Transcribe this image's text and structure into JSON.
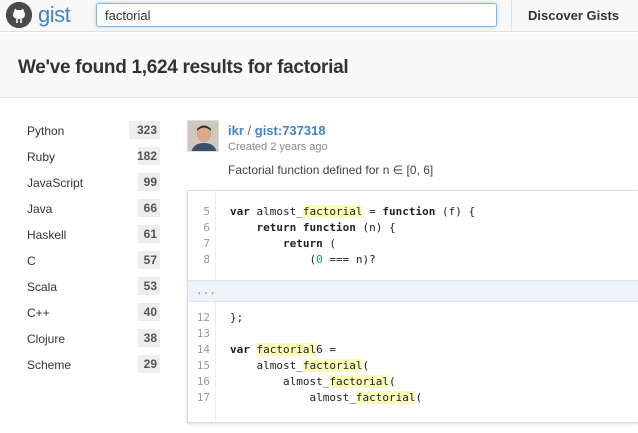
{
  "app": {
    "logo_text": "gist",
    "search_value": "factorial",
    "nav_discover": "Discover Gists"
  },
  "results": {
    "prefix": "We've found 1,624 results for ",
    "query": "factorial"
  },
  "languages": [
    {
      "name": "Python",
      "count": "323",
      "fraction": 1.0
    },
    {
      "name": "Ruby",
      "count": "182",
      "fraction": 0.56
    },
    {
      "name": "JavaScript",
      "count": "99",
      "fraction": 0.31
    },
    {
      "name": "Java",
      "count": "66",
      "fraction": 0.2
    },
    {
      "name": "Haskell",
      "count": "61",
      "fraction": 0.19
    },
    {
      "name": "C",
      "count": "57",
      "fraction": 0.18
    },
    {
      "name": "Scala",
      "count": "53",
      "fraction": 0.16
    },
    {
      "name": "C++",
      "count": "40",
      "fraction": 0.12
    },
    {
      "name": "Clojure",
      "count": "38",
      "fraction": 0.12
    },
    {
      "name": "Scheme",
      "count": "29",
      "fraction": 0.09
    }
  ],
  "gist": {
    "author": "ikr",
    "separator": " / ",
    "gist_id": "gist:737318",
    "created": "Created 2 years ago",
    "description": "Factorial function defined for n ∈ [0, 6]"
  },
  "code": {
    "ellipsis": "...",
    "lines_top": [
      {
        "num": "5",
        "html": "var almost_<span class=\"hl\">factorial</span> = function (f) {"
      },
      {
        "num": "6",
        "html": "    return function (n) {"
      },
      {
        "num": "7",
        "html": "        return ("
      },
      {
        "num": "8",
        "html": "            (<span class=\"num\">0</span> === n)?"
      }
    ],
    "lines_bottom": [
      {
        "num": "12",
        "html": "};"
      },
      {
        "num": "13",
        "html": ""
      },
      {
        "num": "14",
        "html": "var <span class=\"hl\">factorial</span>6 ="
      },
      {
        "num": "15",
        "html": "    almost_<span class=\"hl\">factorial</span>("
      },
      {
        "num": "16",
        "html": "        almost_<span class=\"hl\">factorial</span>("
      },
      {
        "num": "17",
        "html": "            almost_<span class=\"hl\">factorial</span>("
      }
    ]
  },
  "colors": {
    "link": "#4183c4",
    "highlight": "#fffbb8",
    "number": "#1a8d8a"
  }
}
